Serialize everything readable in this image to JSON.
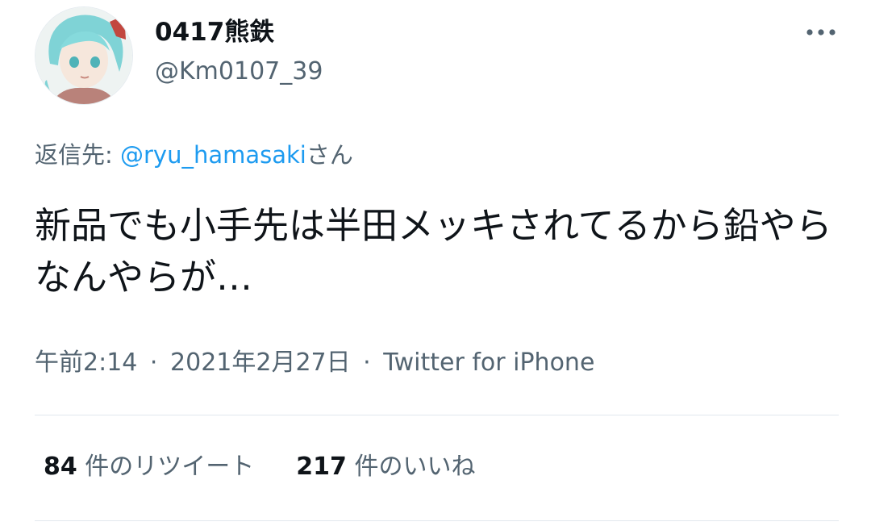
{
  "user": {
    "display_name": "0417熊鉄",
    "handle": "@Km0107_39",
    "avatar_icon": "anime-avatar-icon"
  },
  "header": {
    "more_icon": "more-options-icon"
  },
  "reply": {
    "prefix": "返信先: ",
    "mention": "@ryu_hamasaki",
    "suffix": "さん"
  },
  "tweet": {
    "text": "新品でも小手先は半田メッキされてるから鉛やらなんやらが…"
  },
  "meta": {
    "time": "午前2:14",
    "separator": "·",
    "date": "2021年2月27日",
    "source": "Twitter for iPhone"
  },
  "stats": {
    "retweets_count": "84",
    "retweets_label": "件のリツイート",
    "likes_count": "217",
    "likes_label": "件のいいね"
  },
  "colors": {
    "text": "#0f1419",
    "secondary": "#536471",
    "link": "#1d9bf0",
    "divider": "#e1e8ed"
  }
}
